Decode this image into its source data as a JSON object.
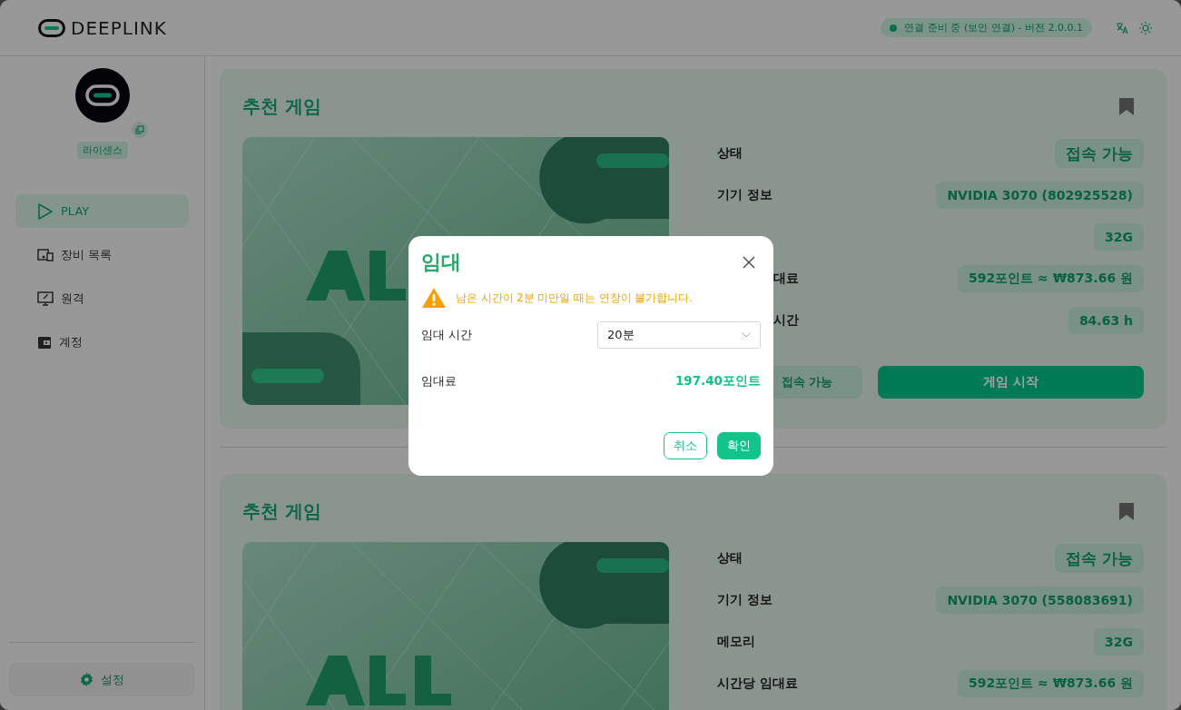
{
  "header": {
    "logo": "DEEPLINK",
    "status": {
      "text": "연결 준비 중 (보안 연결) - 버전 2.0.0.1"
    }
  },
  "sidebar": {
    "badge": "라이센스",
    "items": [
      {
        "label": "PLAY",
        "selected": true
      },
      {
        "label": "장비 목록",
        "selected": false
      },
      {
        "label": "원격",
        "selected": false
      },
      {
        "label": "계정",
        "selected": false
      }
    ],
    "settings": "설정"
  },
  "cards": [
    {
      "title": "추천 게임",
      "image": {
        "kind": "picture"
      },
      "rows": [
        {
          "label": "상태",
          "value": "접속 가능",
          "kind": "status"
        },
        {
          "label": "기기 정보",
          "value": "NVIDIA 3070 (802925528)",
          "kind": "info"
        },
        {
          "value": "32G",
          "kind": "info"
        },
        {
          "label": "대료",
          "value": "592포인트 ≈ ₩873.66 원",
          "kind": "info",
          "covered": true
        },
        {
          "label": "시간",
          "value": "84.63 h",
          "kind": "info",
          "covered": true
        }
      ],
      "buttons": [
        {
          "label": "접속 가능",
          "kind": "secondary"
        },
        {
          "label": "게임 시작",
          "kind": "primary"
        }
      ]
    },
    {
      "title": "추천 게임",
      "image": {
        "kind": "picture"
      },
      "rows": [
        {
          "label": "상태",
          "value": "접속 가능",
          "kind": "status"
        },
        {
          "label": "기기 정보",
          "value": "NVIDIA 3070 (558083691)",
          "kind": "info"
        },
        {
          "label": "메모리",
          "value": "32G",
          "kind": "info"
        },
        {
          "label": "시간당 임대료",
          "value": "592포인트 ≈ ₩873.66 원",
          "kind": "info"
        }
      ]
    }
  ],
  "dialog": {
    "title": "임대",
    "warning": "남은 시간이 2분 미만일 때는 연장이 불가합니다.",
    "fields": [
      {
        "label": "임대 시간",
        "kind": "select",
        "value": "20분"
      },
      {
        "label": "임대료",
        "kind": "amount",
        "value": "197.40포인트"
      }
    ],
    "buttons": [
      {
        "label": "취소",
        "kind": "secondary"
      },
      {
        "label": "확인",
        "kind": "primary"
      }
    ]
  }
}
